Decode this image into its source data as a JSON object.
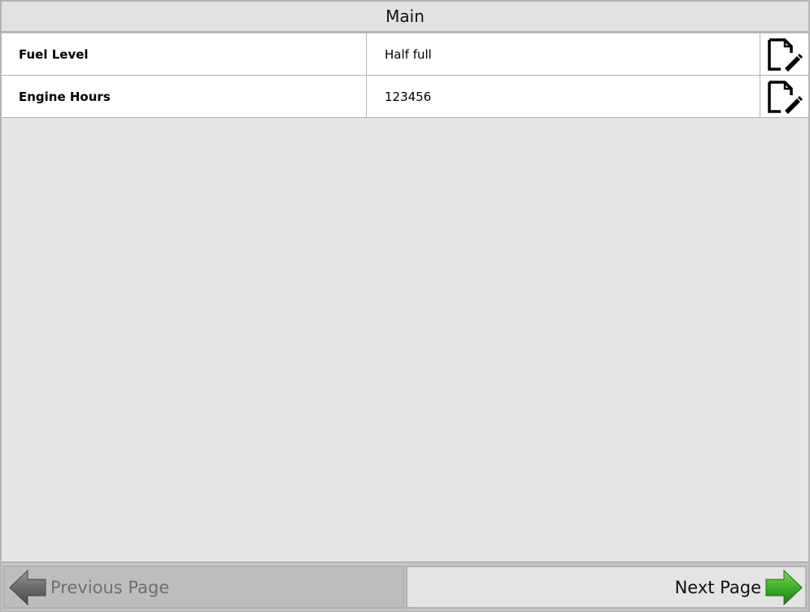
{
  "header": {
    "title": "Main"
  },
  "rows": [
    {
      "label": "Fuel Level",
      "value": "Half full",
      "edit_icon": "edit-document-icon"
    },
    {
      "label": "Engine Hours",
      "value": "123456",
      "edit_icon": "edit-document-icon"
    }
  ],
  "footer": {
    "prev_label": "Previous Page",
    "next_label": "Next Page",
    "prev_icon": "arrow-left-icon",
    "next_icon": "arrow-right-icon"
  },
  "colors": {
    "frame_border": "#b4b4b4",
    "background": "#e6e6e6",
    "row_background": "#ffffff",
    "prev_arrow": "#6a6a6a",
    "next_arrow": "#3fae2a"
  }
}
